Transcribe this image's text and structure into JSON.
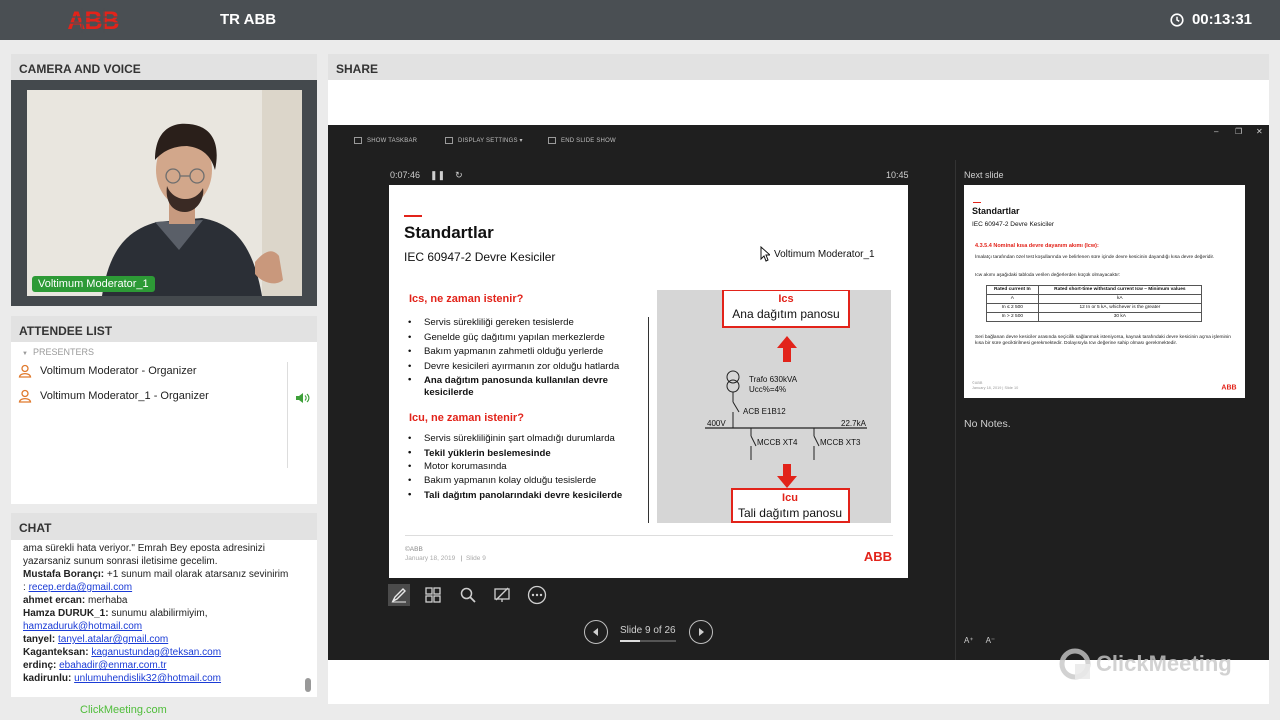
{
  "header": {
    "logo": "ABB",
    "title": "TR ABB",
    "timer": "00:13:31"
  },
  "camera": {
    "heading": "CAMERA AND VOICE",
    "name_tag": "Voltimum Moderator_1"
  },
  "attendees": {
    "heading": "ATTENDEE LIST",
    "section": "PRESENTERS",
    "items": [
      {
        "name": "Voltimum Moderator  - Organizer"
      },
      {
        "name": "Voltimum Moderator_1  - Organizer"
      }
    ]
  },
  "chat": {
    "heading": "CHAT",
    "lines": [
      {
        "sender": "",
        "text": "ama sürekli hata veriyor.\" Emrah Bey eposta adresinizi",
        "link": ""
      },
      {
        "sender": "",
        "text": "yazarsaniz sunum sonrasi iletisime gecelim.",
        "link": ""
      },
      {
        "sender": "Mustafa Borançı:",
        "text": " +1 sunum mail olarak atarsanız sevinirim",
        "link": ""
      },
      {
        "sender": "",
        "text": ": ",
        "link": "recep.erda@gmail.com"
      },
      {
        "sender": "ahmet ercan:",
        "text": " merhaba",
        "link": ""
      },
      {
        "sender": "Hamza DURUK_1:",
        "text": " sunumu alabilirmiyim,",
        "link": ""
      },
      {
        "sender": "",
        "text": "",
        "link": "hamzaduruk@hotmail.com"
      },
      {
        "sender": "tanyel:",
        "text": " ",
        "link": "tanyel.atalar@gmail.com"
      },
      {
        "sender": "Kaganteksan:",
        "text": " ",
        "link": "kaganustundag@teksan.com"
      },
      {
        "sender": "erdinç:",
        "text": " ",
        "link": "ebahadir@enmar.com.tr"
      },
      {
        "sender": "kadirunlu:",
        "text": " ",
        "link": "unlumuhendislik32@hotmail.com"
      }
    ]
  },
  "footer": {
    "brand": "ClickMeeting.com"
  },
  "share": {
    "heading": "SHARE",
    "toolbar": {
      "show_taskbar": "SHOW TASKBAR",
      "display_settings": "DISPLAY SETTINGS ▾",
      "end_show": "END SLIDE SHOW"
    },
    "window_controls": {
      "minimize": "–",
      "restore": "❐",
      "close": "✕"
    },
    "elapsed": "0:07:46",
    "clock": "10:45",
    "next_slide_label": "Next slide",
    "notes": "No Notes.",
    "slide_counter": "Slide 9 of 26",
    "progress": 0.35,
    "overlay_name": "Voltimum Moderator_1",
    "watermark": "ClickMeeting"
  },
  "slide": {
    "title": "Standartlar",
    "subtitle": "IEC 60947-2 Devre Kesiciler",
    "q1": "Ics, ne zaman istenir?",
    "list1": [
      {
        "text": "Servis sürekliliği gereken tesislerde",
        "bold": false
      },
      {
        "text": "Genelde güç dağıtımı yapılan merkezlerde",
        "bold": false
      },
      {
        "text": "Bakım yapmanın zahmetli olduğu yerlerde",
        "bold": false
      },
      {
        "text": "Devre kesicileri ayırmanın zor olduğu hatlarda",
        "bold": false
      },
      {
        "text": "Ana dağıtım panosunda kullanılan devre kesicilerde",
        "bold": true
      }
    ],
    "q2": "Icu, ne zaman istenir?",
    "list2": [
      {
        "text": "Servis sürekliliğinin şart olmadığı durumlarda",
        "bold": false
      },
      {
        "text": "Tekil yüklerin beslemesinde",
        "bold": false
      },
      {
        "text": "Motor korumasında",
        "bold": false
      },
      {
        "text": "Bakım yapmanın kolay olduğu tesislerde",
        "bold": false
      },
      {
        "text": "Tali dağıtım panolarındaki devre kesicilerde",
        "bold": true
      }
    ],
    "diagram": {
      "top_box_title": "Ics",
      "top_box_text": "Ana dağıtım panosu",
      "trafo": "Trafo 630kVA",
      "ucc": "Ucc%=4%",
      "acb": "ACB E1B12",
      "voltage": "400V",
      "current": "22.7kA",
      "mccb1": "MCCB XT4",
      "mccb2": "MCCB XT3",
      "bottom_box_title": "Icu",
      "bottom_box_text": "Tali dağıtım panosu"
    },
    "footer_copy": "©ABB",
    "footer_date": "January 18, 2019",
    "footer_slide": "Slide 9",
    "logo": "ABB"
  },
  "next_slide": {
    "title": "Standartlar",
    "subtitle": "IEC 60947-2 Devre Kesiciler",
    "section": "4.3.5.4 Nominal kısa devre dayanım akımı (Icw):",
    "p1": "İmalatçı tarafından özel test koşullarında ve belirlenen süre içinde devre kesicinin dayandığı kısa devre değeridir.",
    "p2": "Icw akımı aşağıdaki tabloda verilen değerlerden küçük olmayacaktır:",
    "table": [
      [
        "Rated current In",
        "Rated short-time withstand current Icw – Minimum values"
      ],
      [
        "A",
        "kA"
      ],
      [
        "In ≤ 2 500",
        "12 In or 5 kA, whichever is the greater"
      ],
      [
        "In > 2 500",
        "30 kA"
      ]
    ],
    "p3": "Seri bağlanan devre kesiciler arasında seçicilik sağlanmak isteniyorsa, kaynak tarafındaki devre kesicinin açma işleminin kısa bir süre geciktirilmesi gerekmektedir. Dolayısıyla Icw değerine sahip olması gerekmektedir.",
    "footer": "©ABB",
    "footer_date": "January 18, 2019",
    "footer_slide": "Slide 10",
    "logo": "ABB"
  }
}
